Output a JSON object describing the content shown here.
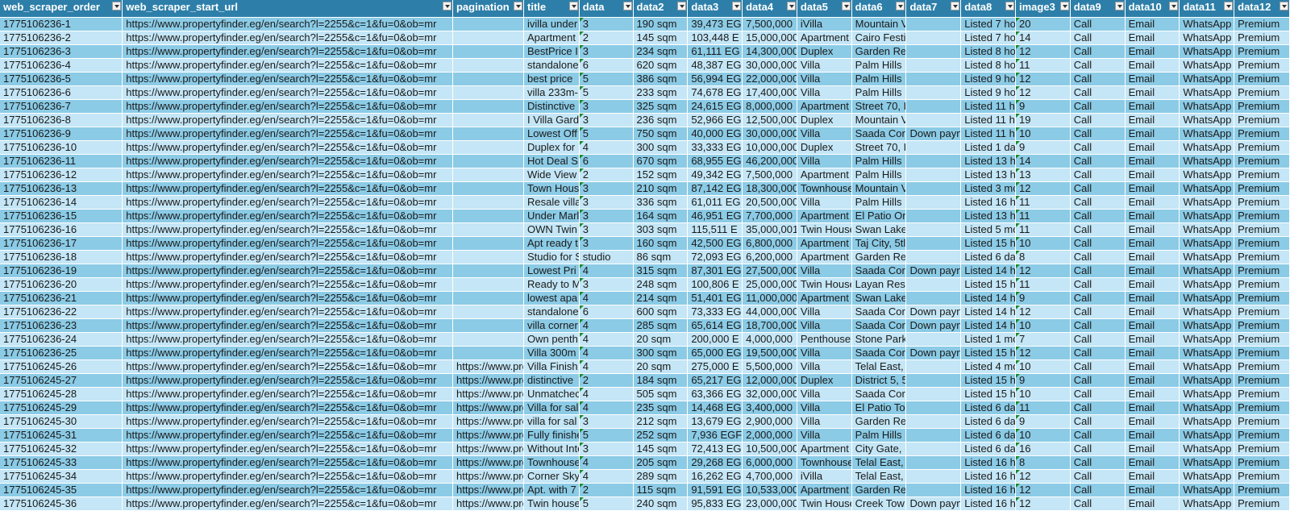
{
  "sheet": {
    "headers": [
      "web_scraper_order",
      "web_scraper_start_url",
      "pagination",
      "title",
      "data",
      "data2",
      "data3",
      "data4",
      "data5",
      "data6",
      "data7",
      "data8",
      "image3",
      "data9",
      "data10",
      "data11",
      "data12"
    ],
    "rows": [
      [
        "1775106236-1",
        "https://www.propertyfinder.eg/en/search?l=2255&c=1&fu=0&ob=mr",
        "",
        "ivilla under",
        "3",
        "190 sqm",
        "39,473 EG",
        "7,500,000",
        "iVilla",
        "Mountain V",
        "",
        "Listed 7 ho",
        "20",
        "Call",
        "Email",
        "WhatsApp",
        "Premium"
      ],
      [
        "1775106236-2",
        "https://www.propertyfinder.eg/en/search?l=2255&c=1&fu=0&ob=mr",
        "",
        "Apartment",
        "2",
        "145 sqm",
        "103,448 E",
        "15,000,000",
        "Apartment",
        "Cairo Festi",
        "",
        "Listed 7 ho",
        "14",
        "Call",
        "Email",
        "WhatsApp",
        "Premium"
      ],
      [
        "1775106236-3",
        "https://www.propertyfinder.eg/en/search?l=2255&c=1&fu=0&ob=mr",
        "",
        "BestPrice I",
        "3",
        "234 sqm",
        "61,111 EG",
        "14,300,000",
        "Duplex",
        "Garden Re",
        "",
        "Listed 8 ho",
        "12",
        "Call",
        "Email",
        "WhatsApp",
        "Premium"
      ],
      [
        "1775106236-4",
        "https://www.propertyfinder.eg/en/search?l=2255&c=1&fu=0&ob=mr",
        "",
        "standalone",
        "6",
        "620 sqm",
        "48,387 EG",
        "30,000,000",
        "Villa",
        "Palm Hills I",
        "",
        "Listed 8 ho",
        "11",
        "Call",
        "Email",
        "WhatsApp",
        "Premium"
      ],
      [
        "1775106236-5",
        "https://www.propertyfinder.eg/en/search?l=2255&c=1&fu=0&ob=mr",
        "",
        "best price",
        "5",
        "386 sqm",
        "56,994 EG",
        "22,000,000",
        "Villa",
        "Palm Hills I",
        "",
        "Listed 9 ho",
        "12",
        "Call",
        "Email",
        "WhatsApp",
        "Premium"
      ],
      [
        "1775106236-6",
        "https://www.propertyfinder.eg/en/search?l=2255&c=1&fu=0&ob=mr",
        "",
        "villa 233m-",
        "5",
        "233 sqm",
        "74,678 EG",
        "17,400,000",
        "Villa",
        "Palm Hills I",
        "",
        "Listed 9 ho",
        "12",
        "Call",
        "Email",
        "WhatsApp",
        "Premium"
      ],
      [
        "1775106236-7",
        "https://www.propertyfinder.eg/en/search?l=2255&c=1&fu=0&ob=mr",
        "",
        "Distinctive",
        "3",
        "325 sqm",
        "24,615 EG",
        "8,000,000",
        "Apartment",
        "Street 70, I",
        "",
        "Listed 11 h",
        "9",
        "Call",
        "Email",
        "WhatsApp",
        "Premium"
      ],
      [
        "1775106236-8",
        "https://www.propertyfinder.eg/en/search?l=2255&c=1&fu=0&ob=mr",
        "",
        "I Villa Gard",
        "3",
        "236 sqm",
        "52,966 EG",
        "12,500,000",
        "Duplex",
        "Mountain V",
        "",
        "Listed 11 h",
        "19",
        "Call",
        "Email",
        "WhatsApp",
        "Premium"
      ],
      [
        "1775106236-9",
        "https://www.propertyfinder.eg/en/search?l=2255&c=1&fu=0&ob=mr",
        "",
        "Lowest Off",
        "5",
        "750 sqm",
        "40,000 EG",
        "30,000,000",
        "Villa",
        "Saada Cor",
        "Down payn",
        "Listed 11 h",
        "10",
        "Call",
        "Email",
        "WhatsApp",
        "Premium"
      ],
      [
        "1775106236-10",
        "https://www.propertyfinder.eg/en/search?l=2255&c=1&fu=0&ob=mr",
        "",
        "Duplex for",
        "4",
        "300 sqm",
        "33,333 EG",
        "10,000,000",
        "Duplex",
        "Street 70, I",
        "",
        "Listed 1 da",
        "9",
        "Call",
        "Email",
        "WhatsApp",
        "Premium"
      ],
      [
        "1775106236-11",
        "https://www.propertyfinder.eg/en/search?l=2255&c=1&fu=0&ob=mr",
        "",
        "Hot Deal S",
        "6",
        "670 sqm",
        "68,955 EG",
        "46,200,000",
        "Villa",
        "Palm Hills I",
        "",
        "Listed 13 h",
        "14",
        "Call",
        "Email",
        "WhatsApp",
        "Premium"
      ],
      [
        "1775106236-12",
        "https://www.propertyfinder.eg/en/search?l=2255&c=1&fu=0&ob=mr",
        "",
        "Wide View",
        "2",
        "152 sqm",
        "49,342 EG",
        "7,500,000",
        "Apartment",
        "Palm Hills I",
        "",
        "Listed 13 h",
        "13",
        "Call",
        "Email",
        "WhatsApp",
        "Premium"
      ],
      [
        "1775106236-13",
        "https://www.propertyfinder.eg/en/search?l=2255&c=1&fu=0&ob=mr",
        "",
        "Town Hous",
        "3",
        "210 sqm",
        "87,142 EG",
        "18,300,000",
        "Townhouse",
        "Mountain V",
        "",
        "Listed 3 mo",
        "12",
        "Call",
        "Email",
        "WhatsApp",
        "Premium"
      ],
      [
        "1775106236-14",
        "https://www.propertyfinder.eg/en/search?l=2255&c=1&fu=0&ob=mr",
        "",
        "Resale villa",
        "3",
        "336 sqm",
        "61,011 EG",
        "20,500,000",
        "Villa",
        "Palm Hills I",
        "",
        "Listed 16 h",
        "11",
        "Call",
        "Email",
        "WhatsApp",
        "Premium"
      ],
      [
        "1775106236-15",
        "https://www.propertyfinder.eg/en/search?l=2255&c=1&fu=0&ob=mr",
        "",
        "Under Marl",
        "3",
        "164 sqm",
        "46,951 EG",
        "7,700,000",
        "Apartment",
        "El Patio Or",
        "",
        "Listed 13 h",
        "11",
        "Call",
        "Email",
        "WhatsApp",
        "Premium"
      ],
      [
        "1775106236-16",
        "https://www.propertyfinder.eg/en/search?l=2255&c=1&fu=0&ob=mr",
        "",
        "OWN Twin",
        "3",
        "303 sqm",
        "115,511 E",
        "35,000,001",
        "Twin House",
        "Swan Lake",
        "",
        "Listed 5 mo",
        "11",
        "Call",
        "Email",
        "WhatsApp",
        "Premium"
      ],
      [
        "1775106236-17",
        "https://www.propertyfinder.eg/en/search?l=2255&c=1&fu=0&ob=mr",
        "",
        "Apt ready t",
        "3",
        "160 sqm",
        "42,500 EG",
        "6,800,000",
        "Apartment",
        "Taj City, 5tl",
        "",
        "Listed 15 h",
        "10",
        "Call",
        "Email",
        "WhatsApp",
        "Premium"
      ],
      [
        "1775106236-18",
        "https://www.propertyfinder.eg/en/search?l=2255&c=1&fu=0&ob=mr",
        "",
        "Studio for S",
        "studio",
        "86 sqm",
        "72,093 EG",
        "6,200,000",
        "Apartment",
        "Garden Re",
        "",
        "Listed 6 da",
        "8",
        "Call",
        "Email",
        "WhatsApp",
        "Premium"
      ],
      [
        "1775106236-19",
        "https://www.propertyfinder.eg/en/search?l=2255&c=1&fu=0&ob=mr",
        "",
        "Lowest Pri",
        "4",
        "315 sqm",
        "87,301 EG",
        "27,500,000",
        "Villa",
        "Saada Cor",
        "Down payn",
        "Listed 14 h",
        "12",
        "Call",
        "Email",
        "WhatsApp",
        "Premium"
      ],
      [
        "1775106236-20",
        "https://www.propertyfinder.eg/en/search?l=2255&c=1&fu=0&ob=mr",
        "",
        "Ready to M",
        "3",
        "248 sqm",
        "100,806 E",
        "25,000,000",
        "Twin House",
        "Layan Resi",
        "",
        "Listed 15 h",
        "11",
        "Call",
        "Email",
        "WhatsApp",
        "Premium"
      ],
      [
        "1775106236-21",
        "https://www.propertyfinder.eg/en/search?l=2255&c=1&fu=0&ob=mr",
        "",
        "lowest apa",
        "4",
        "214 sqm",
        "51,401 EG",
        "11,000,000",
        "Apartment",
        "Swan Lake",
        "",
        "Listed 14 h",
        "9",
        "Call",
        "Email",
        "WhatsApp",
        "Premium"
      ],
      [
        "1775106236-22",
        "https://www.propertyfinder.eg/en/search?l=2255&c=1&fu=0&ob=mr",
        "",
        "standalone",
        "6",
        "600 sqm",
        "73,333 EG",
        "44,000,000",
        "Villa",
        "Saada Cor",
        "Down payn",
        "Listed 14 h",
        "12",
        "Call",
        "Email",
        "WhatsApp",
        "Premium"
      ],
      [
        "1775106236-23",
        "https://www.propertyfinder.eg/en/search?l=2255&c=1&fu=0&ob=mr",
        "",
        "villa corner",
        "4",
        "285 sqm",
        "65,614 EG",
        "18,700,000",
        "Villa",
        "Saada Cor",
        "Down payn",
        "Listed 14 h",
        "10",
        "Call",
        "Email",
        "WhatsApp",
        "Premium"
      ],
      [
        "1775106236-24",
        "https://www.propertyfinder.eg/en/search?l=2255&c=1&fu=0&ob=mr",
        "",
        "Own penth",
        "4",
        "20 sqm",
        "200,000 E",
        "4,000,000",
        "Penthouse",
        "Stone Park",
        "",
        "Listed 1 mo",
        "7",
        "Call",
        "Email",
        "WhatsApp",
        "Premium"
      ],
      [
        "1775106236-25",
        "https://www.propertyfinder.eg/en/search?l=2255&c=1&fu=0&ob=mr",
        "",
        "Villa 300m",
        "4",
        "300 sqm",
        "65,000 EG",
        "19,500,000",
        "Villa",
        "Saada Cor",
        "Down payn",
        "Listed 15 h",
        "12",
        "Call",
        "Email",
        "WhatsApp",
        "Premium"
      ],
      [
        "1775106245-26",
        "https://www.propertyfinder.eg/en/search?l=2255&c=1&fu=0&ob=mr",
        "https://www.pro",
        "Villa Finish",
        "4",
        "20 sqm",
        "275,000 E",
        "5,500,000",
        "Villa",
        "Telal East,",
        "",
        "Listed 4 mo",
        "10",
        "Call",
        "Email",
        "WhatsApp",
        "Premium"
      ],
      [
        "1775106245-27",
        "https://www.propertyfinder.eg/en/search?l=2255&c=1&fu=0&ob=mr",
        "https://www.pro",
        "distinctive",
        "2",
        "184 sqm",
        "65,217 EG",
        "12,000,000",
        "Duplex",
        "District 5, 5",
        "",
        "Listed 15 h",
        "9",
        "Call",
        "Email",
        "WhatsApp",
        "Premium"
      ],
      [
        "1775106245-28",
        "https://www.propertyfinder.eg/en/search?l=2255&c=1&fu=0&ob=mr",
        "https://www.pro",
        "Unmatchec",
        "4",
        "505 sqm",
        "63,366 EG",
        "32,000,000",
        "Villa",
        "Saada Cor",
        "",
        "Listed 15 h",
        "10",
        "Call",
        "Email",
        "WhatsApp",
        "Premium"
      ],
      [
        "1775106245-29",
        "https://www.propertyfinder.eg/en/search?l=2255&c=1&fu=0&ob=mr",
        "https://www.pro",
        "Villa for sal",
        "4",
        "235 sqm",
        "14,468 EG",
        "3,400,000",
        "Villa",
        "El Patio To",
        "",
        "Listed 6 da",
        "11",
        "Call",
        "Email",
        "WhatsApp",
        "Premium"
      ],
      [
        "1775106245-30",
        "https://www.propertyfinder.eg/en/search?l=2255&c=1&fu=0&ob=mr",
        "https://www.pro",
        "villa for sal",
        "3",
        "212 sqm",
        "13,679 EG",
        "2,900,000",
        "Villa",
        "Garden Re",
        "",
        "Listed 6 da",
        "9",
        "Call",
        "Email",
        "WhatsApp",
        "Premium"
      ],
      [
        "1775106245-31",
        "https://www.propertyfinder.eg/en/search?l=2255&c=1&fu=0&ob=mr",
        "https://www.pro",
        "Fully finishe",
        "5",
        "252 sqm",
        "7,936 EGF",
        "2,000,000",
        "Villa",
        "Palm Hills I",
        "",
        "Listed 6 da",
        "10",
        "Call",
        "Email",
        "WhatsApp",
        "Premium"
      ],
      [
        "1775106245-32",
        "https://www.propertyfinder.eg/en/search?l=2255&c=1&fu=0&ob=mr",
        "https://www.pro",
        "Without Inte",
        "3",
        "145 sqm",
        "72,413 EG",
        "10,500,000",
        "Apartment",
        "City Gate, S",
        "",
        "Listed 6 da",
        "16",
        "Call",
        "Email",
        "WhatsApp",
        "Premium"
      ],
      [
        "1775106245-33",
        "https://www.propertyfinder.eg/en/search?l=2255&c=1&fu=0&ob=mr",
        "https://www.pro",
        "Townhouse",
        "4",
        "205 sqm",
        "29,268 EG",
        "6,000,000",
        "Townhouse",
        "Telal East,",
        "",
        "Listed 16 h",
        "8",
        "Call",
        "Email",
        "WhatsApp",
        "Premium"
      ],
      [
        "1775106245-34",
        "https://www.propertyfinder.eg/en/search?l=2255&c=1&fu=0&ob=mr",
        "https://www.pro",
        "Corner Sky",
        "4",
        "289 sqm",
        "16,262 EG",
        "4,700,000",
        "iVilla",
        "Telal East,",
        "",
        "Listed 16 h",
        "12",
        "Call",
        "Email",
        "WhatsApp",
        "Premium"
      ],
      [
        "1775106245-35",
        "https://www.propertyfinder.eg/en/search?l=2255&c=1&fu=0&ob=mr",
        "https://www.pro",
        "Apt. with 7",
        "2",
        "115 sqm",
        "91,591 EG",
        "10,533,000",
        "Apartment",
        "Garden Re",
        "",
        "Listed 16 h",
        "12",
        "Call",
        "Email",
        "WhatsApp",
        "Premium"
      ],
      [
        "1775106245-36",
        "https://www.propertyfinder.eg/en/search?l=2255&c=1&fu=0&ob=mr",
        "https://www.pro",
        "Twin house",
        "5",
        "240 sqm",
        "95,833 EG",
        "23,000,000",
        "Twin House",
        "Creek Tow",
        "Down payn",
        "Listed 16 h",
        "12",
        "Call",
        "Email",
        "WhatsApp",
        "Premium"
      ]
    ]
  }
}
